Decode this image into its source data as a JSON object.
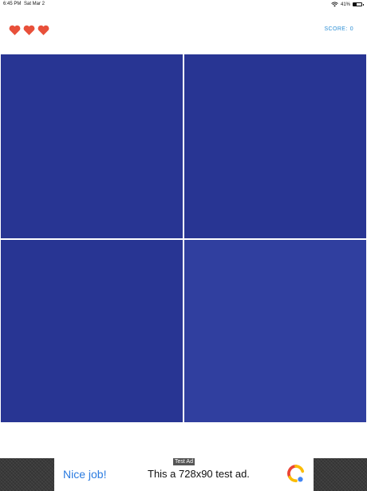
{
  "status_bar": {
    "time": "6:45 PM",
    "date": "Sat Mar 2",
    "battery": "41%",
    "battery_level": 0.41
  },
  "hud": {
    "lives": 3,
    "score_label": "SCORE:",
    "score_value": "0"
  },
  "board": {
    "rows": 2,
    "cols": 2,
    "tile_color": "#283593",
    "highlight_color": "#303f9f",
    "highlighted_tile": 3
  },
  "ad": {
    "tag": "Test Ad",
    "headline": "Nice job!",
    "body": "This a 728x90 test ad."
  },
  "colors": {
    "heart": "#e8503a",
    "score_text": "#2d8fd5",
    "ad_headline": "#2a7be0"
  }
}
